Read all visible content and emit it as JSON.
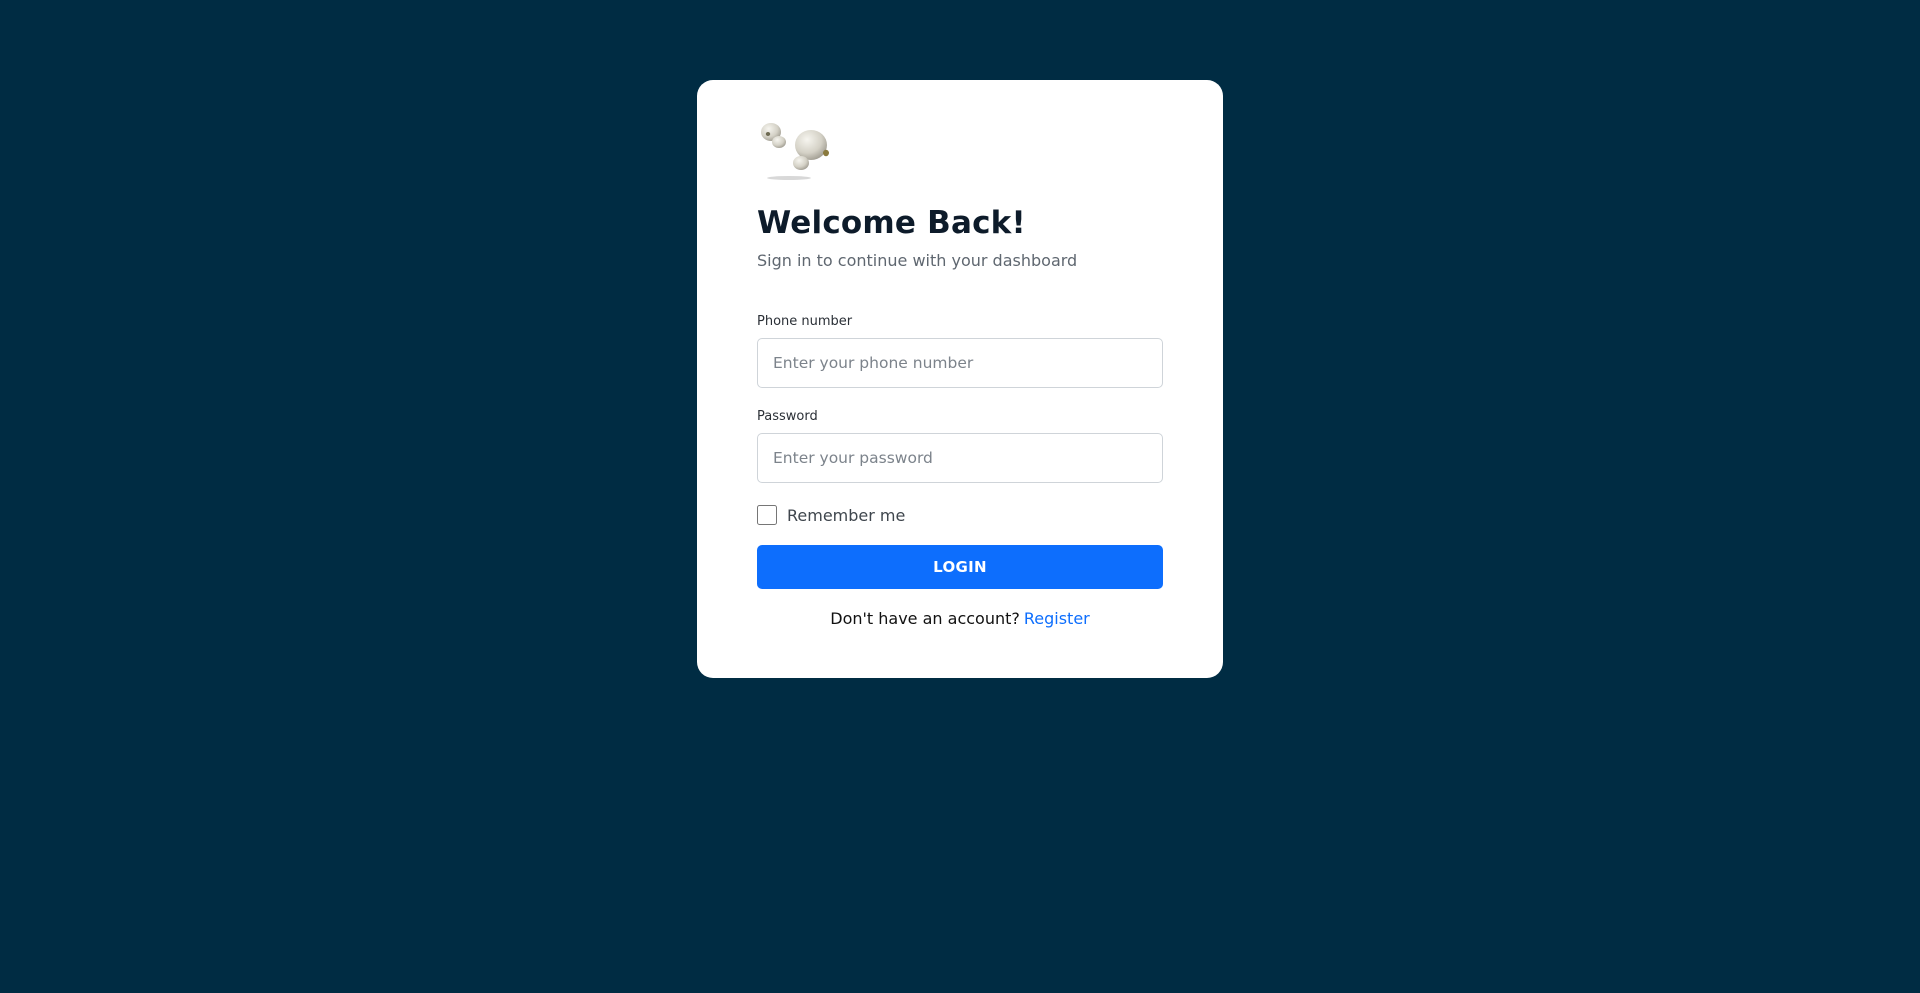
{
  "login_card": {
    "logo_icon": "earbuds-logo-icon",
    "title": "Welcome Back!",
    "subtitle": "Sign in to continue with your dashboard",
    "phone": {
      "label": "Phone number",
      "placeholder": "Enter your phone number",
      "value": ""
    },
    "password": {
      "label": "Password",
      "placeholder": "Enter your password",
      "value": ""
    },
    "remember_label": "Remember me",
    "remember_checked": false,
    "login_label": "LOGIN",
    "register_prompt": "Don't have an account?",
    "register_link": "Register"
  },
  "colors": {
    "background": "#002c43",
    "card": "#ffffff",
    "primary": "#0d6efd",
    "title_text": "#0d1b2a"
  }
}
